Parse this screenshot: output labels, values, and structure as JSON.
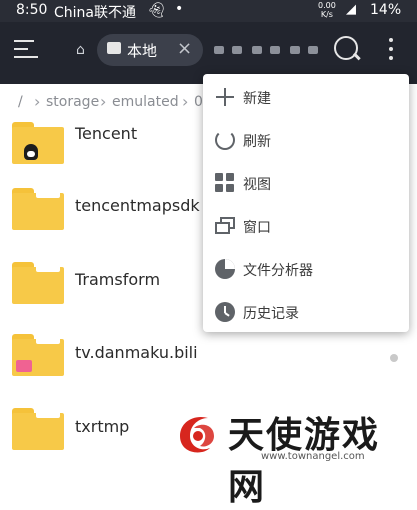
{
  "status_bar": {
    "time": "8:50",
    "carrier": "China联不通",
    "speed_value": "0.00",
    "speed_unit": "K/s",
    "battery": "14%"
  },
  "app_bar": {
    "tab_label": "本地",
    "menu_icon": "hamburger-icon",
    "search_icon": "search-icon",
    "more_icon": "more-vert-icon"
  },
  "breadcrumb": {
    "root": "/",
    "items": [
      "storage",
      "emulated",
      "0"
    ]
  },
  "files": [
    {
      "name": "Tencent",
      "badge": "qq"
    },
    {
      "name": "tencentmapsdk",
      "badge": ""
    },
    {
      "name": "Tramsform",
      "badge": ""
    },
    {
      "name": "tv.danmaku.bili",
      "badge": "bili"
    },
    {
      "name": "txrtmp",
      "badge": ""
    }
  ],
  "popup_menu": {
    "items": [
      {
        "label": "新建",
        "icon": "plus-icon"
      },
      {
        "label": "刷新",
        "icon": "refresh-icon"
      },
      {
        "label": "视图",
        "icon": "grid-view-icon"
      },
      {
        "label": "窗口",
        "icon": "window-icon"
      },
      {
        "label": "文件分析器",
        "icon": "pie-chart-icon"
      },
      {
        "label": "历史记录",
        "icon": "clock-icon"
      }
    ]
  },
  "watermark": {
    "title": "天使游戏网",
    "url": "www.townangel.com"
  },
  "colors": {
    "app_bar": "#22252e",
    "status_bar": "#2a2d36",
    "folder": "#f7c948",
    "watermark_red": "#d7261e"
  }
}
